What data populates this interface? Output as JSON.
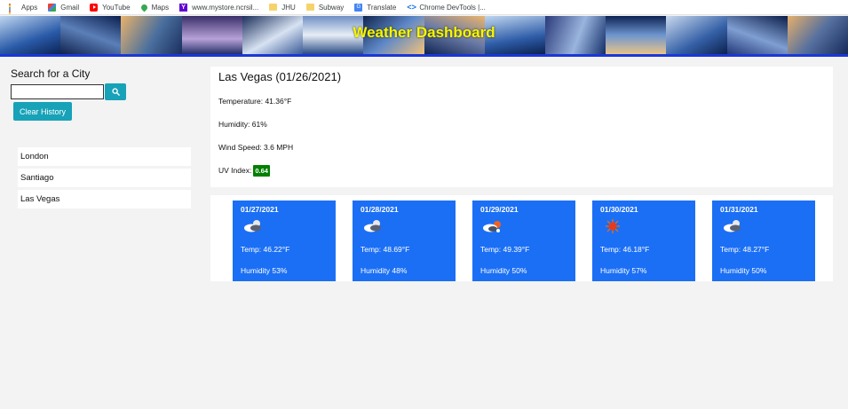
{
  "bookmarks": [
    {
      "label": "Apps",
      "icon": "apps-icon"
    },
    {
      "label": "Gmail",
      "icon": "gmail-icon"
    },
    {
      "label": "YouTube",
      "icon": "youtube-icon"
    },
    {
      "label": "Maps",
      "icon": "maps-icon"
    },
    {
      "label": "www.mystore.ncrsil...",
      "icon": "yahoo-icon"
    },
    {
      "label": "JHU",
      "icon": "folder-icon"
    },
    {
      "label": "Subway",
      "icon": "folder-icon"
    },
    {
      "label": "Translate",
      "icon": "translate-icon"
    },
    {
      "label": "Chrome DevTools |...",
      "icon": "devtools-icon"
    }
  ],
  "header": {
    "title": "Weather Dashboard",
    "title_color": "#f7f700"
  },
  "sidebar": {
    "search_label": "Search for a City",
    "search_value": "",
    "clear_label": "Clear History",
    "history": [
      "London",
      "Santiago",
      "Las Vegas"
    ]
  },
  "current": {
    "title": "Las Vegas (01/26/2021)",
    "temperature": "Temperature: 41.36°F",
    "humidity": "Humidity: 61%",
    "wind": "Wind Speed: 3.6 MPH",
    "uv_label": "UV Index:",
    "uv_value": "0.64",
    "uv_color": "#008000"
  },
  "forecast": [
    {
      "date": "01/27/2021",
      "icon": "partly-cloudy-icon",
      "temp": "Temp: 46.22°F",
      "humidity": "Humidity 53%"
    },
    {
      "date": "01/28/2021",
      "icon": "partly-cloudy-icon",
      "temp": "Temp: 48.69°F",
      "humidity": "Humidity 48%"
    },
    {
      "date": "01/29/2021",
      "icon": "scattered-clouds-icon",
      "temp": "Temp: 49.39°F",
      "humidity": "Humidity 50%"
    },
    {
      "date": "01/30/2021",
      "icon": "sun-icon",
      "temp": "Temp: 46.18°F",
      "humidity": "Humidity 57%"
    },
    {
      "date": "01/31/2021",
      "icon": "partly-cloudy-icon",
      "temp": "Temp: 48.27°F",
      "humidity": "Humidity 50%"
    }
  ]
}
